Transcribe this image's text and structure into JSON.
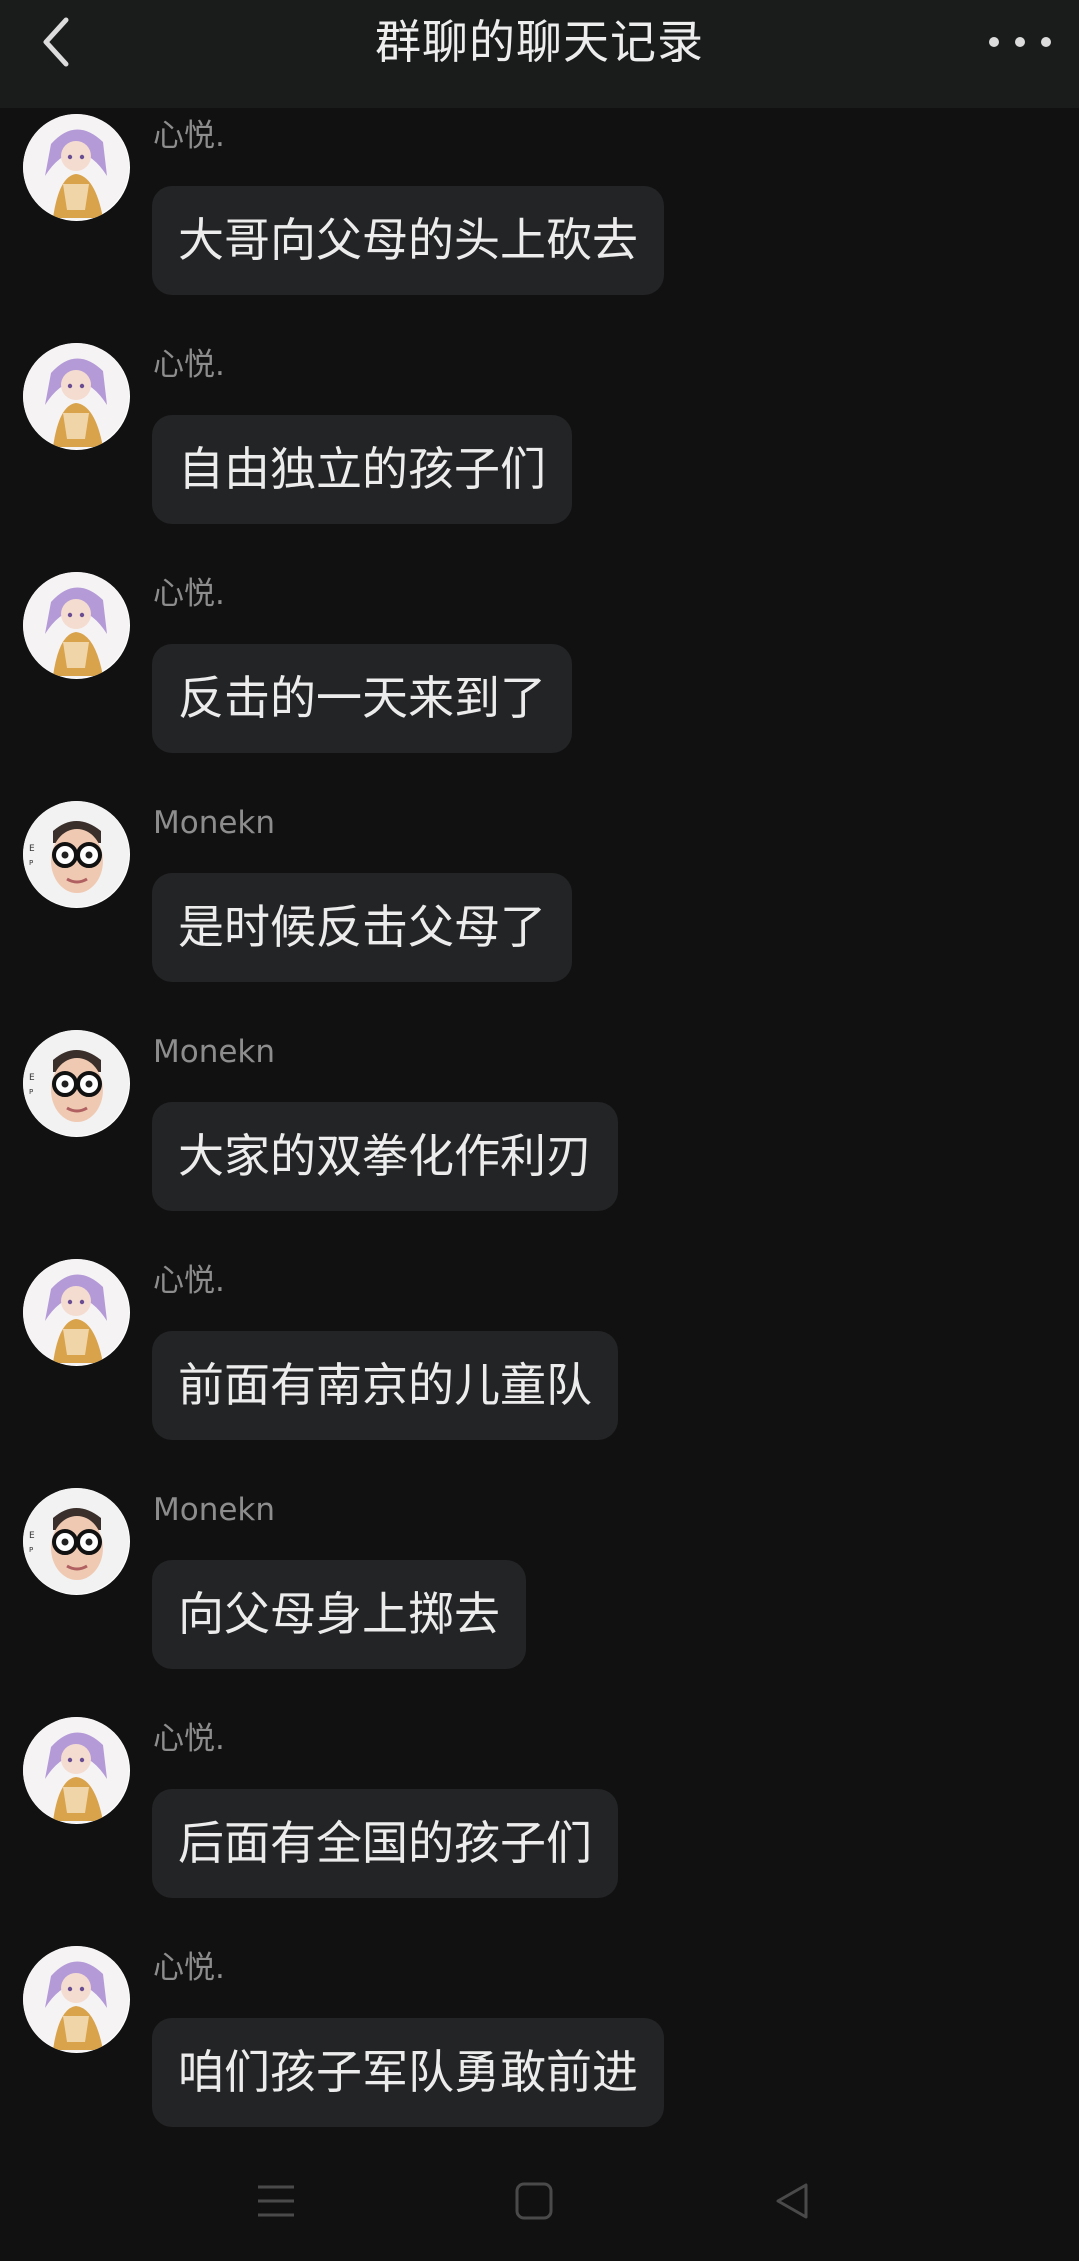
{
  "header": {
    "title": "群聊的聊天记录",
    "back_icon": "chevron-left-icon",
    "more_icon": "more-horizontal-icon"
  },
  "messages": [
    {
      "sender": "心悦.",
      "avatar": "anime-girl-avatar",
      "text": "大哥向父母的头上砍去"
    },
    {
      "sender": "心悦.",
      "avatar": "anime-girl-avatar",
      "text": "自由独立的孩子们"
    },
    {
      "sender": "心悦.",
      "avatar": "anime-girl-avatar",
      "text": "反击的一天来到了"
    },
    {
      "sender": "Monekn",
      "avatar": "glasses-boy-avatar",
      "text": "是时候反击父母了"
    },
    {
      "sender": "Monekn",
      "avatar": "glasses-boy-avatar",
      "text": "大家的双拳化作利刃"
    },
    {
      "sender": "心悦.",
      "avatar": "anime-girl-avatar",
      "text": "前面有南京的儿童队"
    },
    {
      "sender": "Monekn",
      "avatar": "glasses-boy-avatar",
      "text": "向父母身上掷去"
    },
    {
      "sender": "心悦.",
      "avatar": "anime-girl-avatar",
      "text": "后面有全国的孩子们"
    },
    {
      "sender": "心悦.",
      "avatar": "anime-girl-avatar",
      "text": "咱们孩子军队勇敢前进"
    }
  ],
  "navbar": {
    "menu_icon": "menu-icon",
    "home_icon": "home-square-icon",
    "back_icon": "back-triangle-icon"
  },
  "colors": {
    "background": "#111111",
    "header": "#1a1b1b",
    "bubble": "#232426",
    "sender_text": "#8d8d8d",
    "message_text": "#ececec"
  }
}
